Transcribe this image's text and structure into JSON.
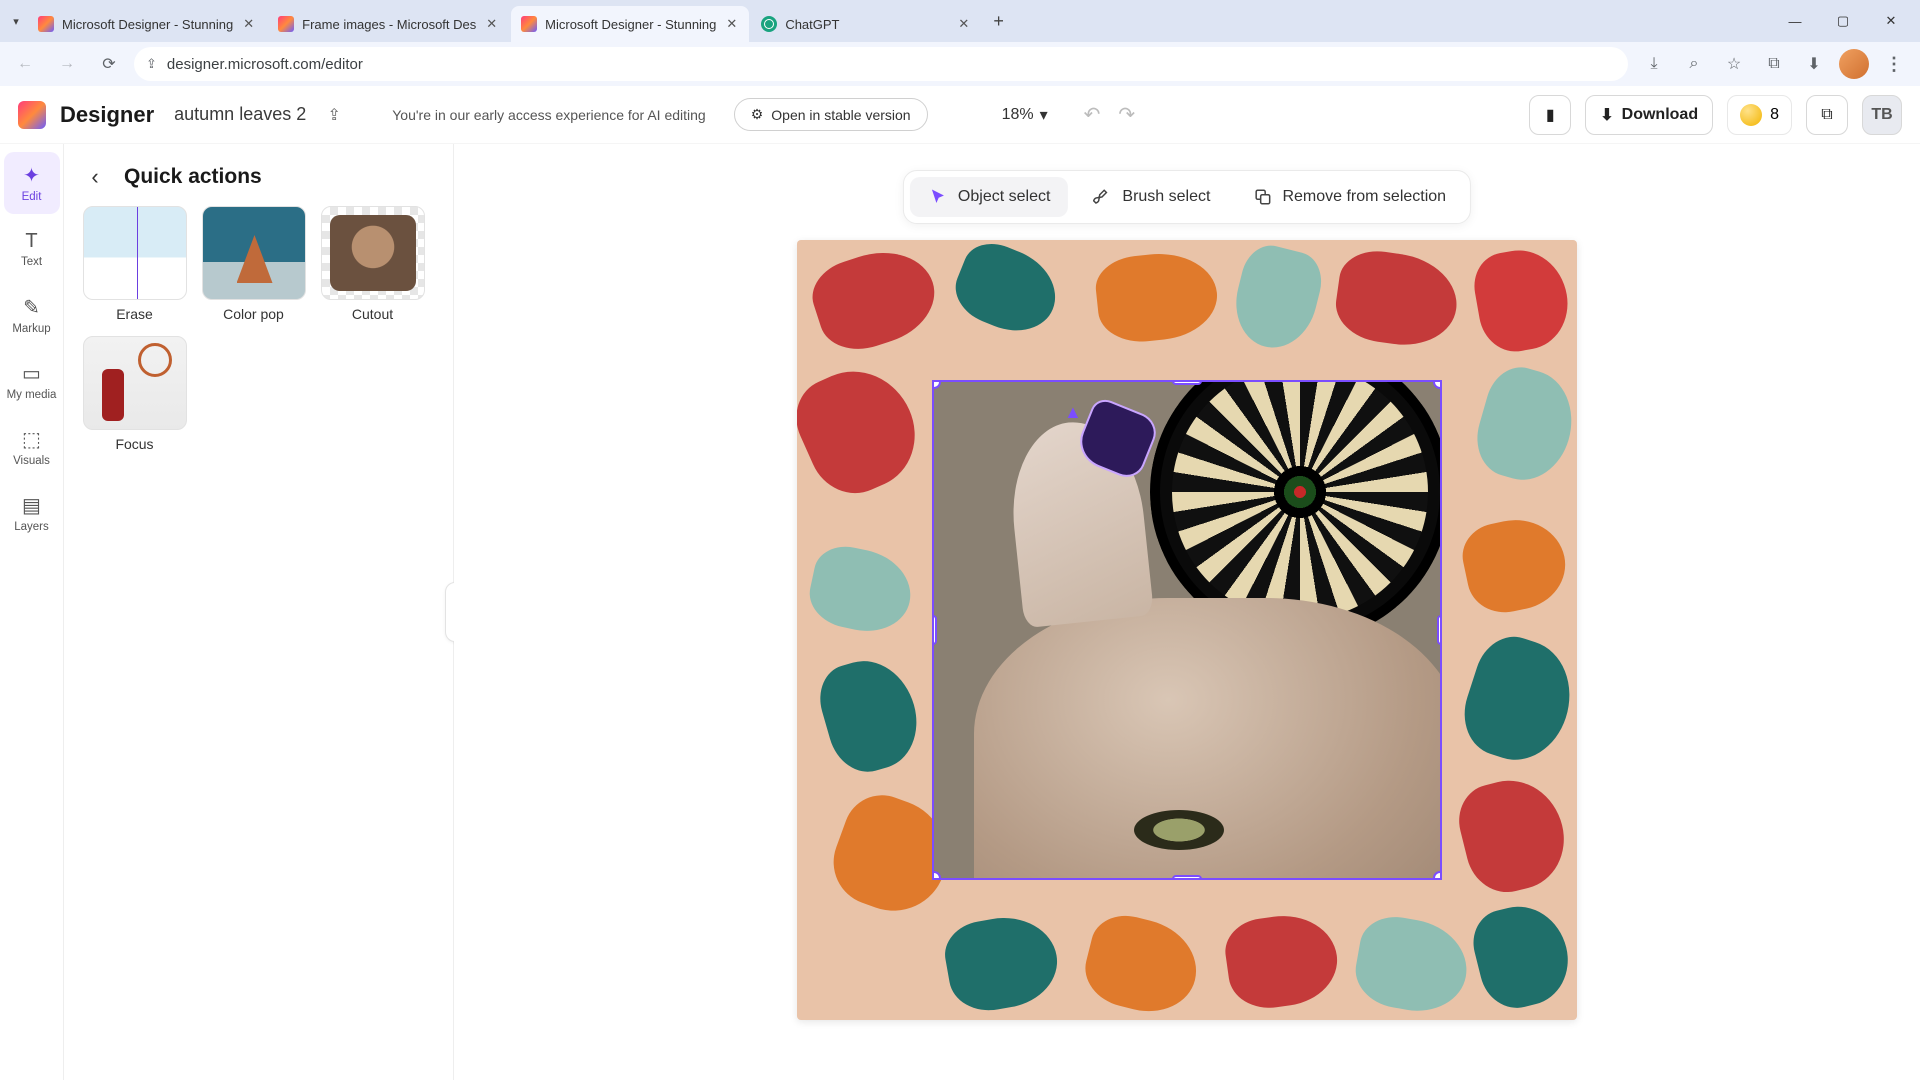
{
  "browser": {
    "tabs": [
      {
        "title": "Microsoft Designer - Stunning",
        "favicon": "designer",
        "active": false
      },
      {
        "title": "Frame images - Microsoft Des",
        "favicon": "designer",
        "active": false
      },
      {
        "title": "Microsoft Designer - Stunning",
        "favicon": "designer",
        "active": true
      },
      {
        "title": "ChatGPT",
        "favicon": "chatgpt",
        "active": false
      }
    ],
    "url": "designer.microsoft.com/editor"
  },
  "header": {
    "app_name": "Designer",
    "doc_name": "autumn leaves 2",
    "ai_banner": "You're in our early access experience for AI editing",
    "stable_btn": "Open in stable version",
    "zoom": "18%",
    "download_label": "Download",
    "credits": "8",
    "user_initials": "TB"
  },
  "rail": {
    "items": [
      {
        "label": "Edit",
        "icon": "✦"
      },
      {
        "label": "Text",
        "icon": "T"
      },
      {
        "label": "Markup",
        "icon": "✎"
      },
      {
        "label": "My media",
        "icon": "▭"
      },
      {
        "label": "Visuals",
        "icon": "⬚"
      },
      {
        "label": "Layers",
        "icon": "▤"
      }
    ]
  },
  "panel": {
    "title": "Quick actions",
    "actions": [
      {
        "label": "Erase"
      },
      {
        "label": "Color pop"
      },
      {
        "label": "Cutout"
      },
      {
        "label": "Focus"
      }
    ]
  },
  "selection_toolbar": {
    "object_select": "Object select",
    "brush_select": "Brush select",
    "remove": "Remove from selection"
  },
  "icons": {
    "chevron_down": "▾",
    "close_x": "✕",
    "plus": "+",
    "minimize": "—",
    "maximize": "▢",
    "back": "←",
    "forward": "→",
    "reload": "⟳",
    "lock": "⇪",
    "install": "⤓",
    "zoom_lens": "⌕",
    "star": "☆",
    "puzzle": "⧉",
    "download_tray": "⬇",
    "dots": "⋮",
    "undo": "↶",
    "redo": "↷",
    "phone": "▮",
    "copy": "⧉",
    "share": "⇪",
    "chevron_left": "‹",
    "rotate": "↻"
  }
}
